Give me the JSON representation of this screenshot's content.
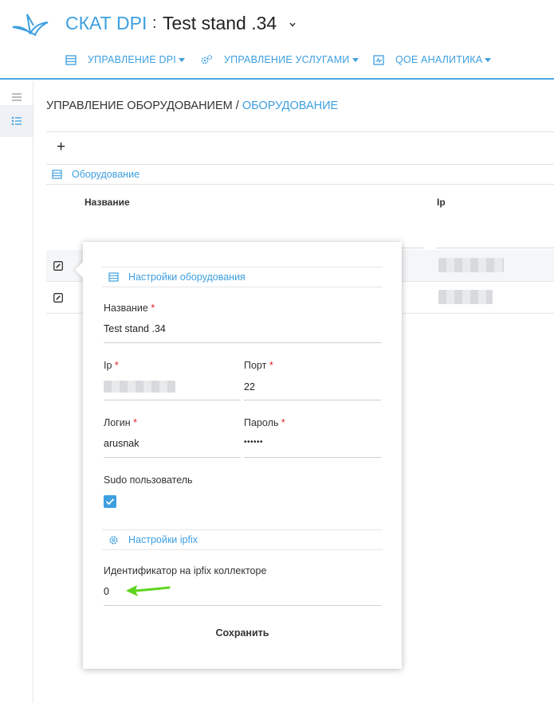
{
  "header": {
    "brand": "СКАТ DPI",
    "separator": ":",
    "stand_name": "Test stand .34",
    "nav": [
      {
        "label": "УПРАВЛЕНИЕ DPI",
        "icon": "server-icon"
      },
      {
        "label": "УПРАВЛЕНИЕ УСЛУГАМИ",
        "icon": "gears-icon"
      },
      {
        "label": "QOE АНАЛИТИКА",
        "icon": "chart-icon"
      }
    ]
  },
  "breadcrumb": {
    "parent": "УПРАВЛЕНИЕ ОБОРУДОВАНИЕМ",
    "divider": " / ",
    "current": "ОБОРУДОВАНИЕ"
  },
  "toolbar": {
    "add_label": "+"
  },
  "table": {
    "section_title": "Оборудование",
    "columns": [
      "Название",
      "Ip"
    ]
  },
  "popup": {
    "equipment_section": "Настройки оборудования",
    "name_label": "Название",
    "name_value": "Test stand .34",
    "ip_label": "Ip",
    "port_label": "Порт",
    "port_value": "22",
    "login_label": "Логин",
    "login_value": "arusnak",
    "password_label": "Пароль",
    "password_value": "••••••",
    "sudo_label": "Sudo пользователь",
    "sudo_checked": true,
    "ipfix_section": "Настройки ipfix",
    "ipfix_id_label": "Идентификатор на ipfix коллекторе",
    "ipfix_id_value": "0",
    "save_label": "Сохранить",
    "required_mark": "*"
  },
  "colors": {
    "accent": "#3d9fe0",
    "required": "#e02020",
    "annotation_arrow": "#5fd41e"
  }
}
